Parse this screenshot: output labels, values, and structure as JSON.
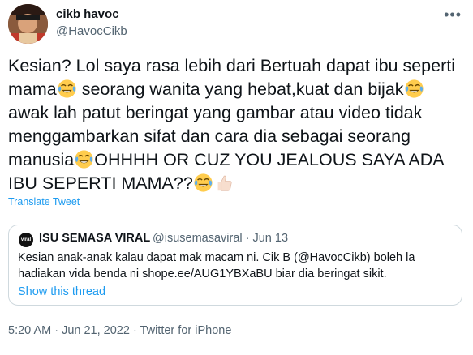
{
  "author": {
    "name": "cikb havoc",
    "handle": "@HavocCikb"
  },
  "tweet": {
    "segments": [
      {
        "text": "Kesian? Lol saya rasa lebih dari Bertuah dapat ibu seperti mama"
      },
      {
        "emoji": "face-with-tears-of-joy"
      },
      {
        "text": " seorang wanita yang hebat,kuat dan bijak"
      },
      {
        "emoji": "face-with-tears-of-joy"
      },
      {
        "text": " awak lah patut beringat yang gambar atau video tidak menggambarkan sifat dan cara dia sebagai seorang manusia"
      },
      {
        "emoji": "face-with-tears-of-joy"
      },
      {
        "text": "OHHHH OR CUZ YOU JEALOUS SAYA ADA IBU SEPERTI MAMA??"
      },
      {
        "emoji": "face-with-tears-of-joy"
      },
      {
        "emoji": "thumbs-up-light-skin"
      }
    ],
    "translate_label": "Translate Tweet"
  },
  "quote": {
    "avatar_text": "viral",
    "name": "ISU SEMASA VIRAL",
    "meta": "@isusemasaviral · Jun 13",
    "text": "Kesian anak-anak kalau dapat mak macam ni. Cik B (@HavocCikb) boleh la hadiakan  vida benda ni shope.ee/AUG1YBXaBU biar dia beringat sikit.",
    "show_thread": "Show this thread"
  },
  "footer": "5:20 AM · Jun 21, 2022 · Twitter for iPhone",
  "colors": {
    "link": "#1d9bf0",
    "secondary": "#536471",
    "border": "#cfd9de"
  }
}
